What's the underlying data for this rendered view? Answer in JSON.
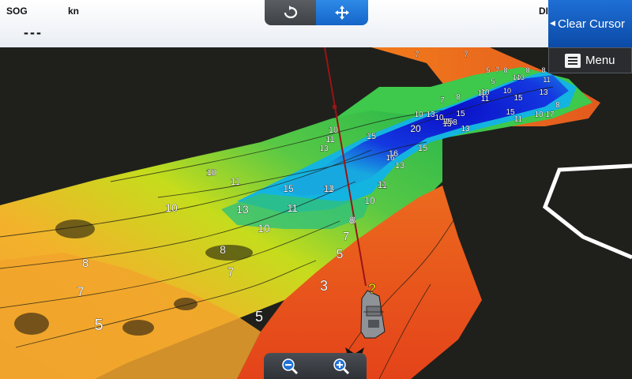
{
  "header": {
    "sog_label": "SOG",
    "sog_unit": "kn",
    "sog_value": "---",
    "right_label": "DI"
  },
  "view_toggle": {
    "rotate_icon": "rotate-icon",
    "pan_icon": "pan-icon",
    "active": "pan"
  },
  "actions": {
    "clear_cursor_label": "Clear Cursor",
    "menu_label": "Menu",
    "menu_icon": "menu-list-icon"
  },
  "zoom": {
    "zoom_out_icon": "zoom-out-icon",
    "zoom_in_icon": "zoom-in-icon"
  },
  "cursor_marker": "?",
  "depth_labels": [
    "7",
    "7",
    "5",
    "7",
    "8",
    "8",
    "8",
    "10",
    "11",
    "5",
    "10",
    "13",
    "10",
    "15",
    "7",
    "8",
    "10",
    "11",
    "13",
    "8",
    "10",
    "13",
    "15",
    "15",
    "11",
    "10",
    "17",
    "8",
    "10",
    "11",
    "15",
    "20",
    "15",
    "10",
    "13",
    "11",
    "16",
    "15",
    "13",
    "13",
    "11",
    "10",
    "15",
    "13",
    "11",
    "16",
    "8",
    "10",
    "11",
    "15",
    "10",
    "13",
    "11",
    "10",
    "13",
    "11",
    "10",
    "8",
    "7",
    "5",
    "8",
    "7",
    "3",
    "8",
    "7",
    "5",
    "5"
  ],
  "colors": {
    "shallow": "#e0401a",
    "mid_shallow": "#f0a820",
    "mid": "#d8e018",
    "mid_deep": "#36c948",
    "deep": "#12b0d8",
    "deepest": "#1020d8",
    "course_line": "#9a1414",
    "button_active": "#1e6fd6"
  }
}
